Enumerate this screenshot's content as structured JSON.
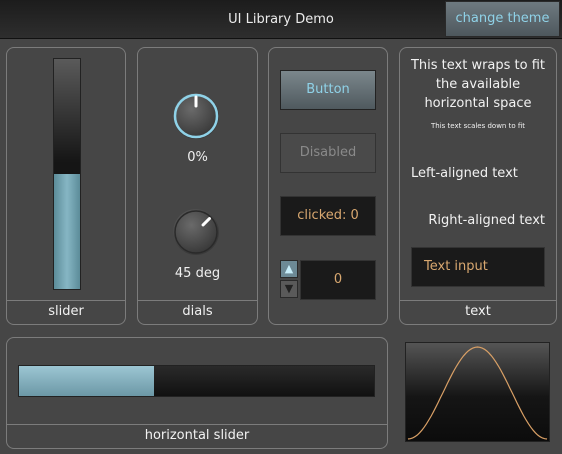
{
  "window": {
    "title": "UI Library Demo",
    "theme_button": "change theme"
  },
  "slider_panel": {
    "caption": "slider",
    "value_fraction": 0.5
  },
  "dials_panel": {
    "caption": "dials",
    "dial1": {
      "label": "0%",
      "angle_deg": 0
    },
    "dial2": {
      "label": "45 deg",
      "angle_deg": 45
    }
  },
  "buttons_panel": {
    "button": "Button",
    "disabled": "Disabled",
    "counter": "clicked: 0",
    "spin_up": "▲",
    "spin_down": "▼",
    "spin_value": "0"
  },
  "text_panel": {
    "caption": "text",
    "wrap": "This text wraps to fit the available horizontal space",
    "scaled": "This text scales down to fit",
    "left": "Left-aligned text",
    "right": "Right-aligned text",
    "input_value": "Text input"
  },
  "hslider_panel": {
    "caption": "horizontal slider",
    "value_fraction": 0.38
  },
  "colors": {
    "accent": "#8fd2e8",
    "fill": "#7fb0bf",
    "value_text": "#d9a870",
    "curve": "#d9a066"
  }
}
